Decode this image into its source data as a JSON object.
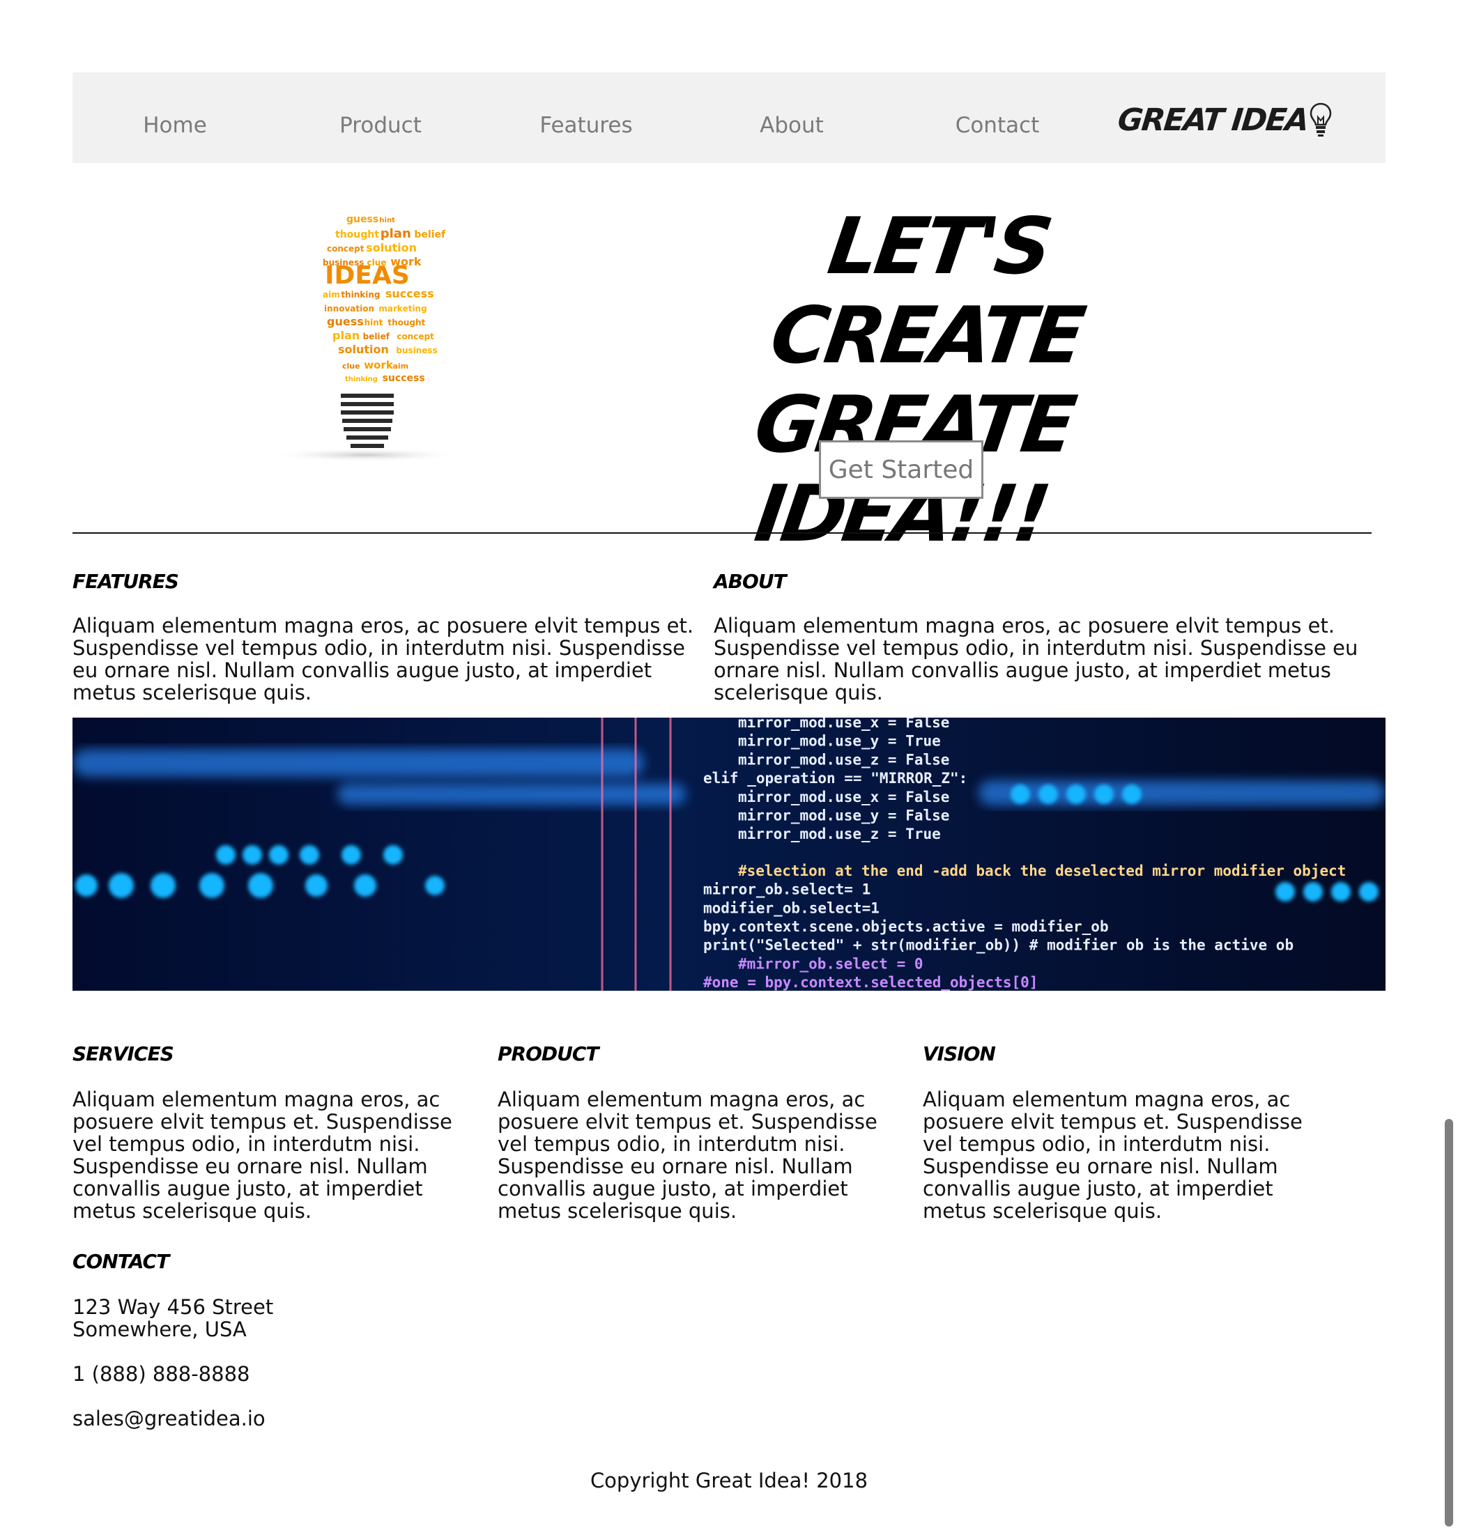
{
  "nav": {
    "links": [
      "Home",
      "Product",
      "Features",
      "About",
      "Contact"
    ],
    "brand": "GREAT IDEA"
  },
  "hero": {
    "title_line1": "LET'S CREATE",
    "title_line2": "GREATE IDEA!!!",
    "cta_label": "Get Started",
    "art": {
      "big_word": "IDEAS",
      "words": [
        "guess",
        "hint",
        "thought",
        "plan",
        "belief",
        "concept",
        "solution",
        "business",
        "clue",
        "work",
        "aim",
        "thinking",
        "success",
        "innovation",
        "marketing"
      ]
    }
  },
  "features": {
    "heading": "FEATURES",
    "text": "Aliquam elementum magna eros, ac posuere elvit tempus et. Suspendisse vel tempus odio, in interdutm nisi. Suspendisse eu ornare nisl. Nullam convallis augue justo, at imperdiet metus scelerisque quis."
  },
  "about": {
    "heading": "ABOUT",
    "text": "Aliquam elementum magna eros, ac posuere elvit tempus et. Suspendisse vel tempus odio, in interdutm nisi. Suspendisse eu ornare nisl. Nullam convallis augue justo, at imperdiet metus scelerisque quis."
  },
  "banner": {
    "code_lines": [
      "mirror_mod.use_x = False",
      "mirror_mod.use_y = True",
      "mirror_mod.use_z = False",
      "elif _operation == \"MIRROR_Z\":",
      "mirror_mod.use_x = False",
      "mirror_mod.use_y = False",
      "mirror_mod.use_z = True",
      "#selection at the end -add back the deselected mirror modifier object",
      "mirror_ob.select= 1",
      "modifier_ob.select=1",
      "bpy.context.scene.objects.active = modifier_ob",
      "print(\"Selected\" + str(modifier_ob)) # modifier ob is the active ob",
      "#mirror_ob.select = 0",
      "#one = bpy.context.selected_objects[0]"
    ]
  },
  "services": {
    "heading": "SERVICES",
    "text": "Aliquam elementum magna eros, ac posuere elvit tempus et. Suspendisse vel tempus odio, in interdutm nisi. Suspendisse eu ornare nisl. Nullam convallis augue justo, at imperdiet metus scelerisque quis."
  },
  "product": {
    "heading": "PRODUCT",
    "text": "Aliquam elementum magna eros, ac posuere elvit tempus et. Suspendisse vel tempus odio, in interdutm nisi. Suspendisse eu ornare nisl. Nullam convallis augue justo, at imperdiet metus scelerisque quis."
  },
  "vision": {
    "heading": "VISION",
    "text": "Aliquam elementum magna eros, ac posuere elvit tempus et. Suspendisse vel tempus odio, in interdutm nisi. Suspendisse eu ornare nisl. Nullam convallis augue justo, at imperdiet metus scelerisque quis."
  },
  "contact": {
    "heading": "CONTACT",
    "address_line1": "123 Way 456 Street",
    "address_line2": "Somewhere, USA",
    "phone": "1 (888) 888-8888",
    "email": "sales@greatidea.io"
  },
  "footer": {
    "copyright": "Copyright Great Idea! 2018"
  },
  "colors": {
    "nav_bg": "#f1f1f1",
    "nav_text": "#7a7a7a",
    "accent_orange": "#f5a000",
    "banner_bg": "#050a2a"
  }
}
